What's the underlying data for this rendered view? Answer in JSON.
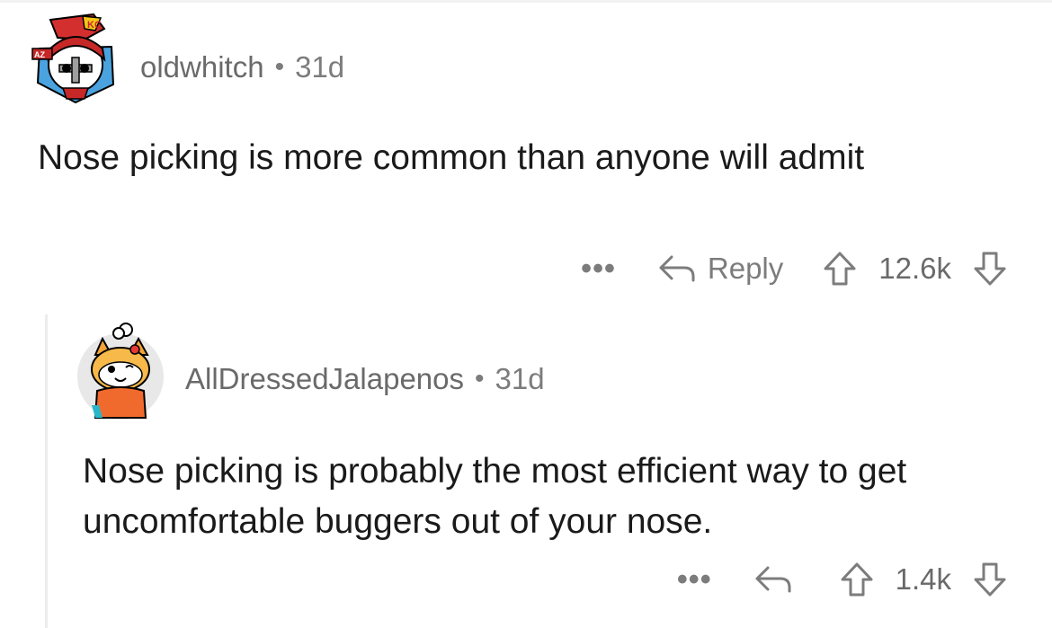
{
  "comments": [
    {
      "username": "oldwhitch",
      "age": "31d",
      "body": "Nose picking is more common than anyone will admit",
      "actions": {
        "more": "•••",
        "reply": "Reply",
        "score": "12.6k"
      }
    },
    {
      "username": "AllDressedJalapenos",
      "age": "31d",
      "body": "Nose picking is probably the most efficient way to get uncomfortable buggers out of your nose.",
      "actions": {
        "more": "•••",
        "score": "1.4k"
      }
    }
  ],
  "separator": "•",
  "icons": {
    "reply": "reply-arrow-icon",
    "upvote": "upvote-arrow-icon",
    "downvote": "downvote-arrow-icon"
  },
  "colors": {
    "text": "#1a1a1b",
    "meta": "#7c7c7c",
    "thread_line": "#ececec"
  }
}
